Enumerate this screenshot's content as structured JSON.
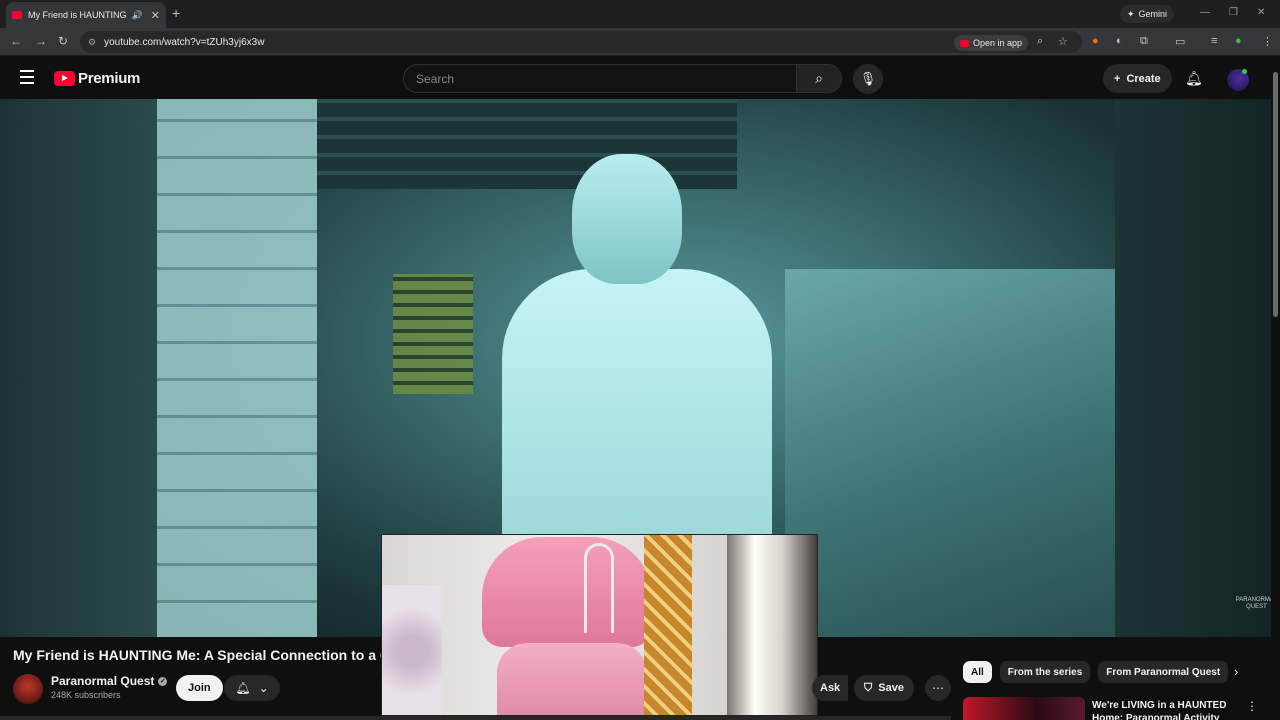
{
  "browser": {
    "tab_title": "My Friend is HAUNTING Me: A Special Connection",
    "tab_speaker": "🔊",
    "tab_close": "✕",
    "new_tab": "+",
    "gemini_label": "Gemini",
    "url": "youtube.com/watch?v=tZUh3yj6x3w",
    "open_in_app": "Open in app"
  },
  "youtube": {
    "brand": "Premium",
    "search_placeholder": "Search",
    "create_label": "Create"
  },
  "video": {
    "title": "My Friend is HAUNTING Me: A Special Connection to a G",
    "watermark": "PARANORMAL QUEST"
  },
  "channel": {
    "name": "Paranormal Quest",
    "subscribers": "248K subscribers",
    "join_label": "Join"
  },
  "actions": {
    "ask_label": "Ask",
    "save_label": "Save"
  },
  "chips": [
    "All",
    "From the series",
    "From Paranormal Quest"
  ],
  "recommended": {
    "title": "We're LIVING in a HAUNTED Home: Paranormal Activity"
  },
  "colors": {
    "accent": "#ff0033",
    "background": "#0f0f0f"
  }
}
